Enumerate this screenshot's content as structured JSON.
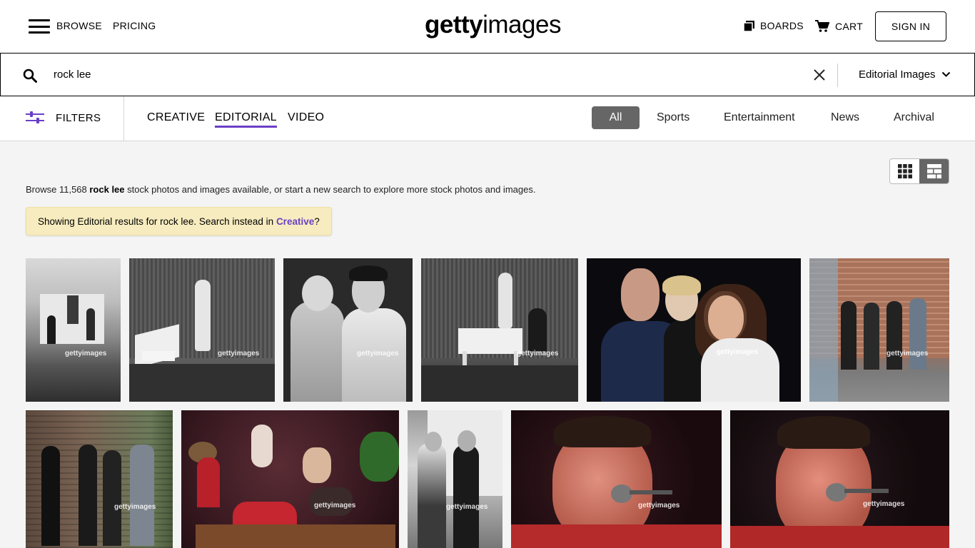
{
  "header": {
    "browse": "BROWSE",
    "pricing": "PRICING",
    "logo_bold": "getty",
    "logo_light": "images",
    "boards": "BOARDS",
    "cart": "CART",
    "sign_in": "SIGN IN"
  },
  "search": {
    "query": "rock lee",
    "type": "Editorial Images"
  },
  "filterbar": {
    "filters": "FILTERS",
    "asset_tabs": [
      "CREATIVE",
      "EDITORIAL",
      "VIDEO"
    ],
    "categories": [
      "All",
      "Sports",
      "Entertainment",
      "News",
      "Archival"
    ]
  },
  "results": {
    "browse_prefix": "Browse 11,568 ",
    "browse_query": "rock lee",
    "browse_suffix": " stock photos and images available, or start a new search to explore more stock photos and images.",
    "notice_prefix": "Showing Editorial results for rock lee. Search instead in ",
    "notice_link": "Creative",
    "notice_suffix": "?",
    "watermark": "gettyimages"
  },
  "colors": {
    "accent": "#6a3fc6",
    "notice_bg": "#f7ecbf",
    "active_chip": "#666666"
  },
  "icons": [
    "menu-icon",
    "boards-icon",
    "cart-icon",
    "search-icon",
    "close-icon",
    "chevron-down-icon",
    "filters-icon",
    "grid-view-icon",
    "mosaic-view-icon"
  ]
}
